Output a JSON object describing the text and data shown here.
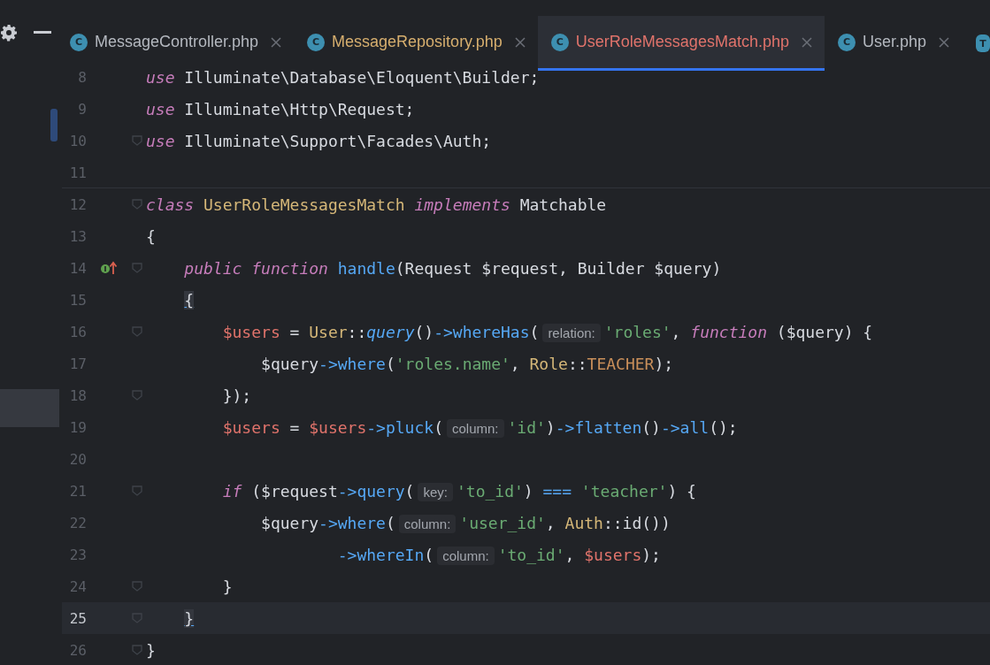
{
  "toolbar": {
    "buttons": [
      {
        "kind": "settings"
      },
      {
        "kind": "minimize"
      }
    ]
  },
  "tabs": [
    {
      "label": "MessageController.php",
      "icon": "C",
      "color": "#b4b8bf",
      "selected": false
    },
    {
      "label": "MessageRepository.php",
      "icon": "C",
      "color": "#d6ae6e",
      "selected": false
    },
    {
      "label": "UserRoleMessagesMatch.php",
      "icon": "C",
      "color": "#e0736b",
      "selected": true
    },
    {
      "label": "User.php",
      "icon": "C",
      "color": "#b4b8bf",
      "selected": false
    }
  ],
  "partial_tab": {
    "icon": "T"
  },
  "editor": {
    "lines": [
      {
        "number": "8",
        "current": false,
        "fold": false,
        "tokens": [
          {
            "kind": "kw",
            "text": "use"
          },
          {
            "kind": "p",
            "text": " Illuminate\\Database\\Eloquent\\Builder;"
          }
        ]
      },
      {
        "number": "9",
        "current": false,
        "fold": false,
        "tokens": [
          {
            "kind": "kw",
            "text": "use"
          },
          {
            "kind": "p",
            "text": " Illuminate\\Http\\Request;"
          }
        ]
      },
      {
        "number": "10",
        "current": false,
        "fold": true,
        "tokens": [
          {
            "kind": "kw",
            "text": "use"
          },
          {
            "kind": "p",
            "text": " Illuminate\\Support\\Facades\\Auth;"
          }
        ]
      },
      {
        "number": "11",
        "current": false,
        "fold": false
      },
      {
        "number": "12",
        "current": false,
        "fold": true,
        "tokens": [
          {
            "kind": "kw",
            "text": "class"
          },
          {
            "kind": "cls",
            "text": " UserRoleMessagesMatch"
          },
          {
            "kind": "kw",
            "text": " implements"
          },
          {
            "kind": "p",
            "text": " Matchable"
          }
        ]
      },
      {
        "number": "13",
        "current": false,
        "fold": false,
        "tokens": [
          {
            "kind": "p",
            "text": "{"
          }
        ]
      },
      {
        "number": "14",
        "current": false,
        "fold": true,
        "gutter_icon": {
          "kind": "implements"
        },
        "tokens": [
          {
            "kind": "kw",
            "text": "    public function"
          },
          {
            "kind": "fn",
            "text": " handle"
          },
          {
            "kind": "p",
            "text": "(Request $request, Builder $query)"
          }
        ]
      },
      {
        "number": "15",
        "current": false,
        "fold": false,
        "tokens": [
          {
            "kind": "match",
            "text": "    {"
          }
        ]
      },
      {
        "number": "16",
        "current": false,
        "fold": true,
        "tokens": [
          {
            "kind": "var",
            "text": "        $users"
          },
          {
            "kind": "p",
            "text": " = "
          },
          {
            "kind": "cls",
            "text": "User"
          },
          {
            "kind": "p",
            "text": "::"
          },
          {
            "kind": "sfn",
            "text": "query"
          },
          {
            "kind": "p",
            "text": "()"
          },
          {
            "kind": "fn",
            "text": "->whereHas"
          },
          {
            "kind": "p",
            "text": "("
          },
          {
            "kind": "hint",
            "text": "relation:"
          },
          {
            "kind": "str",
            "text": "'roles'"
          },
          {
            "kind": "p",
            "text": ", "
          },
          {
            "kind": "kw",
            "text": "function"
          },
          {
            "kind": "p",
            "text": " ($query) {"
          }
        ]
      },
      {
        "number": "17",
        "current": false,
        "fold": false,
        "tokens": [
          {
            "kind": "p",
            "text": "            $query"
          },
          {
            "kind": "fn",
            "text": "->where"
          },
          {
            "kind": "p",
            "text": "("
          },
          {
            "kind": "str",
            "text": "'roles.name'"
          },
          {
            "kind": "p",
            "text": ", "
          },
          {
            "kind": "cls",
            "text": "Role"
          },
          {
            "kind": "p",
            "text": "::"
          },
          {
            "kind": "const",
            "text": "TEACHER"
          },
          {
            "kind": "p",
            "text": ");"
          }
        ]
      },
      {
        "number": "18",
        "current": false,
        "fold": true,
        "tokens": [
          {
            "kind": "p",
            "text": "        });"
          }
        ]
      },
      {
        "number": "19",
        "current": false,
        "fold": false,
        "tokens": [
          {
            "kind": "var",
            "text": "        $users"
          },
          {
            "kind": "p",
            "text": " = "
          },
          {
            "kind": "var",
            "text": "$users"
          },
          {
            "kind": "fn",
            "text": "->pluck"
          },
          {
            "kind": "p",
            "text": "("
          },
          {
            "kind": "hint",
            "text": "column:"
          },
          {
            "kind": "str",
            "text": "'id'"
          },
          {
            "kind": "p",
            "text": ")"
          },
          {
            "kind": "fn",
            "text": "->flatten"
          },
          {
            "kind": "p",
            "text": "()"
          },
          {
            "kind": "fn",
            "text": "->all"
          },
          {
            "kind": "p",
            "text": "();"
          }
        ]
      },
      {
        "number": "20",
        "current": false,
        "fold": false
      },
      {
        "number": "21",
        "current": false,
        "fold": true,
        "tokens": [
          {
            "kind": "kw",
            "text": "        if"
          },
          {
            "kind": "p",
            "text": " ($request"
          },
          {
            "kind": "fn",
            "text": "->query"
          },
          {
            "kind": "p",
            "text": "("
          },
          {
            "kind": "hint",
            "text": "key:"
          },
          {
            "kind": "str",
            "text": "'to_id'"
          },
          {
            "kind": "p",
            "text": ") "
          },
          {
            "kind": "op",
            "text": "==="
          },
          {
            "kind": "str",
            "text": " 'teacher'"
          },
          {
            "kind": "p",
            "text": ") {"
          }
        ]
      },
      {
        "number": "22",
        "current": false,
        "fold": false,
        "tokens": [
          {
            "kind": "p",
            "text": "            $query"
          },
          {
            "kind": "fn",
            "text": "->where"
          },
          {
            "kind": "p",
            "text": "("
          },
          {
            "kind": "hint",
            "text": "column:"
          },
          {
            "kind": "str",
            "text": "'user_id'"
          },
          {
            "kind": "p",
            "text": ", "
          },
          {
            "kind": "cls",
            "text": "Auth"
          },
          {
            "kind": "p",
            "text": "::id())"
          }
        ]
      },
      {
        "number": "23",
        "current": false,
        "fold": false,
        "tokens": [
          {
            "kind": "fn",
            "text": "                    ->whereIn"
          },
          {
            "kind": "p",
            "text": "("
          },
          {
            "kind": "hint",
            "text": "column:"
          },
          {
            "kind": "str",
            "text": "'to_id'"
          },
          {
            "kind": "p",
            "text": ", "
          },
          {
            "kind": "var",
            "text": "$users"
          },
          {
            "kind": "p",
            "text": ");"
          }
        ]
      },
      {
        "number": "24",
        "current": false,
        "fold": true,
        "tokens": [
          {
            "kind": "p",
            "text": "        }"
          }
        ]
      },
      {
        "number": "25",
        "current": true,
        "fold": true,
        "tokens": [
          {
            "kind": "match",
            "text": "    }"
          }
        ]
      },
      {
        "number": "26",
        "current": false,
        "fold": true,
        "tokens": [
          {
            "kind": "p",
            "text": "}"
          }
        ]
      }
    ]
  }
}
